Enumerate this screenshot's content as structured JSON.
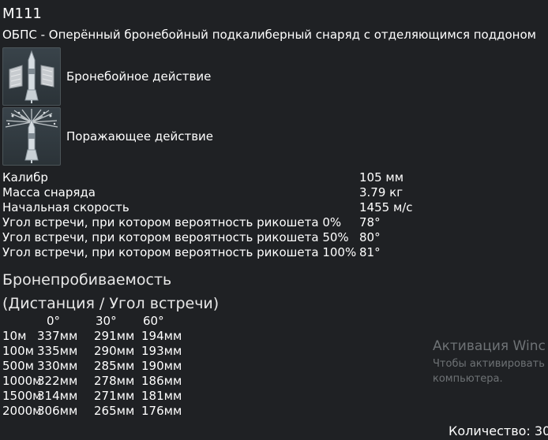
{
  "shell": {
    "name": "M111",
    "description": "ОБПС - Оперённый бронебойный подкалиберный снаряд с отделяющимся поддоном"
  },
  "effects": [
    {
      "label": "Бронебойное действие",
      "icon": "armor-piercing-effect-icon"
    },
    {
      "label": "Поражающее действие",
      "icon": "damage-effect-icon"
    }
  ],
  "stats": [
    {
      "label": "Калибр",
      "value": "105 мм"
    },
    {
      "label": "Масса снаряда",
      "value": "3.79 кг"
    },
    {
      "label": "Начальная скорость",
      "value": "1455 м/с"
    },
    {
      "label": "Угол встречи, при котором вероятность рикошета 0%",
      "value": "78°"
    },
    {
      "label": "Угол встречи, при котором вероятность рикошета 50%",
      "value": "80°"
    },
    {
      "label": "Угол встречи, при котором вероятность рикошета 100%",
      "value": "81°"
    }
  ],
  "penetration": {
    "title": "Бронепробиваемость",
    "subtitle": "(Дистанция / Угол встречи)",
    "angles": [
      "0°",
      "30°",
      "60°"
    ],
    "rows": [
      {
        "distance": "10м",
        "values": [
          "337мм",
          "291мм",
          "194мм"
        ]
      },
      {
        "distance": "100м",
        "values": [
          "335мм",
          "290мм",
          "193мм"
        ]
      },
      {
        "distance": "500м",
        "values": [
          "330мм",
          "285мм",
          "190мм"
        ]
      },
      {
        "distance": "1000м",
        "values": [
          "322мм",
          "278мм",
          "186мм"
        ]
      },
      {
        "distance": "1500м",
        "values": [
          "314мм",
          "271мм",
          "181мм"
        ]
      },
      {
        "distance": "2000м",
        "values": [
          "306мм",
          "265мм",
          "176мм"
        ]
      }
    ]
  },
  "watermark": {
    "title": "Активация Winc",
    "line1": "Чтобы активировать",
    "line2": "компьютера."
  },
  "footer": {
    "quantity": "Количество: 30"
  },
  "colors": {
    "background": "#1f2124",
    "text": "#ffffff",
    "watermark": "#6e7275"
  }
}
